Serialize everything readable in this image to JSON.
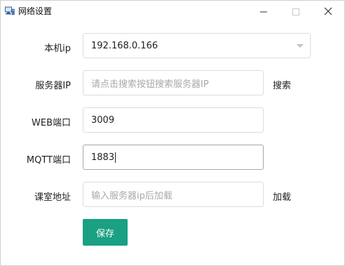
{
  "window": {
    "title": "网络设置",
    "app_icon": "monitor-network-icon"
  },
  "form": {
    "local_ip": {
      "label": "本机ip",
      "value": "192.168.0.166"
    },
    "server_ip": {
      "label": "服务器IP",
      "placeholder": "请点击搜索按钮搜索服务器IP",
      "value": "",
      "action_label": "搜索"
    },
    "web_port": {
      "label": "WEB端口",
      "value": "3009"
    },
    "mqtt_port": {
      "label": "MQTT端口",
      "value": "1883"
    },
    "classroom_address": {
      "label": "课室地址",
      "placeholder": "输入服务器ip后加载",
      "value": "",
      "action_label": "加载"
    },
    "save_label": "保存"
  },
  "colors": {
    "primary_button": "#1aa083",
    "border": "#dcdcdc",
    "placeholder": "#a8a8a8"
  }
}
